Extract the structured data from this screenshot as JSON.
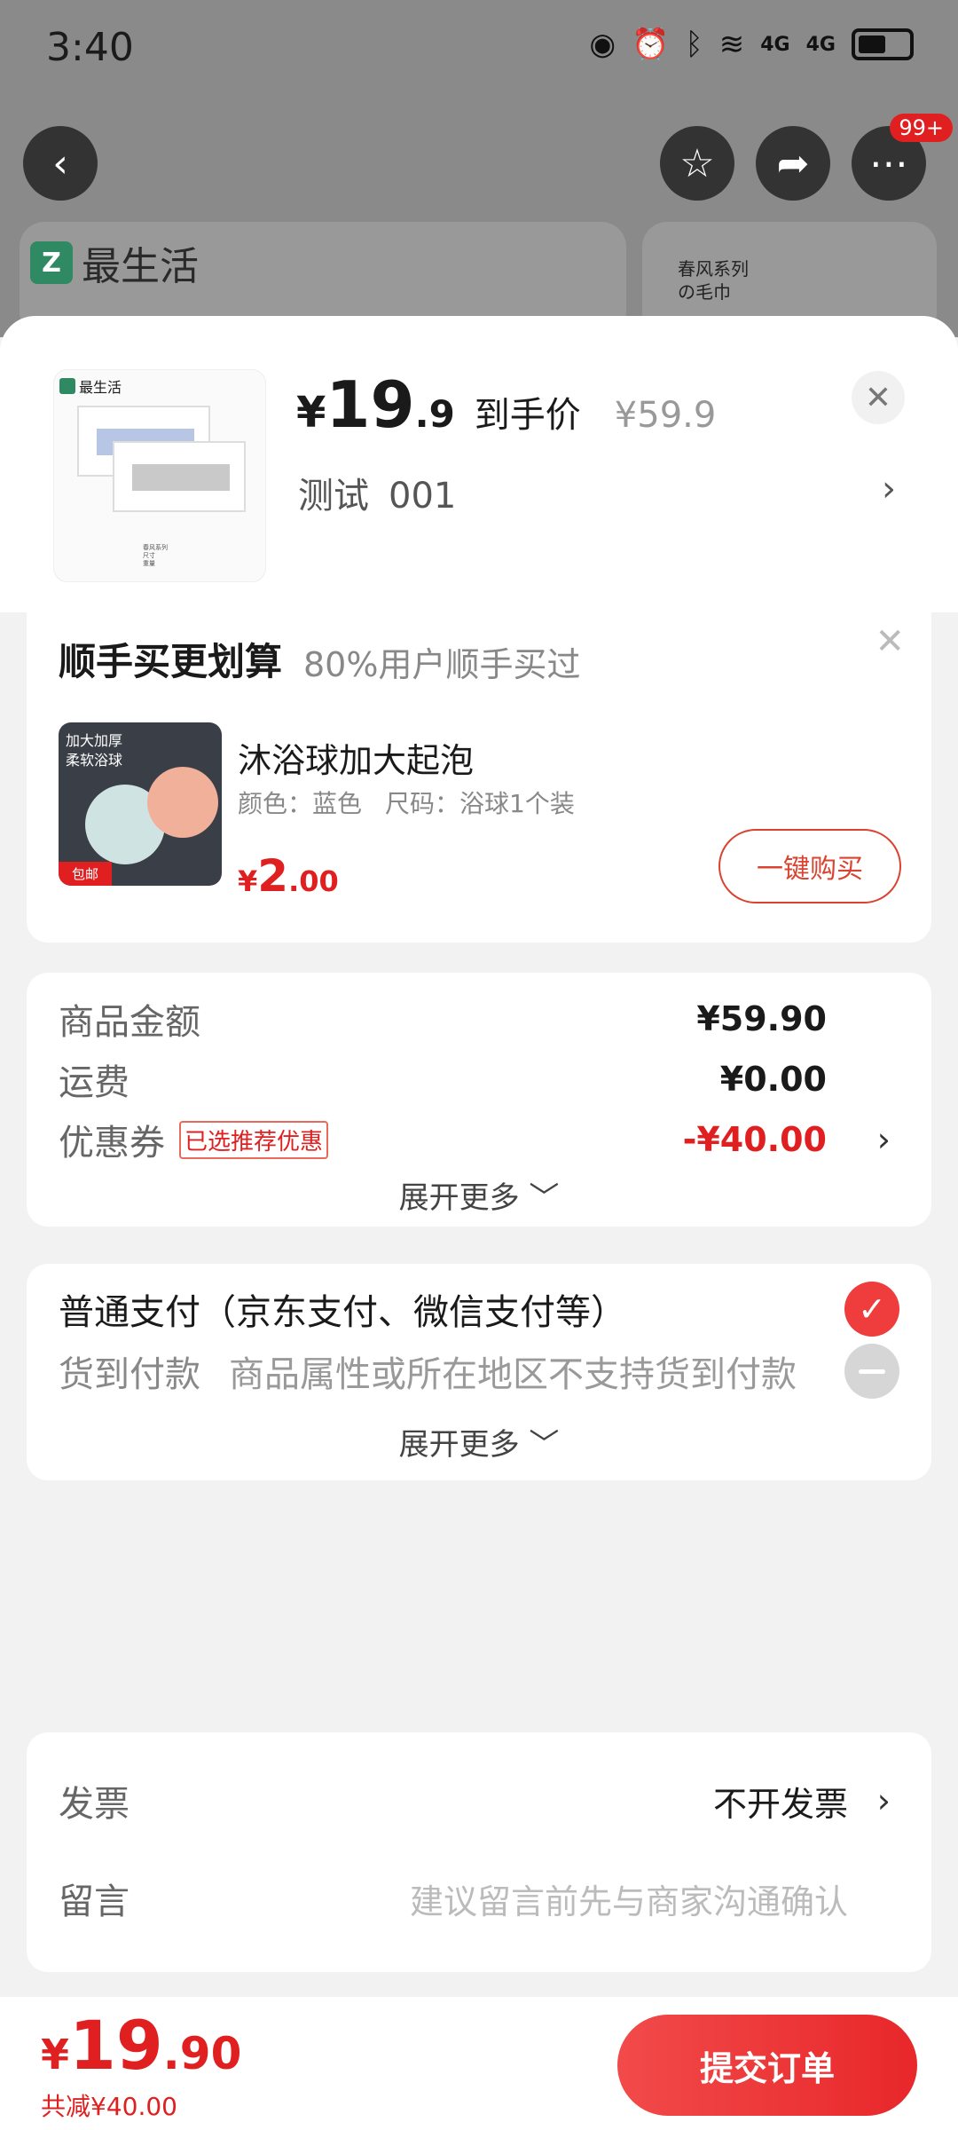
{
  "status_bar": {
    "time": "3:40",
    "net1": "4G",
    "net2": "4G"
  },
  "background": {
    "back_icon": "‹",
    "more_badge": "99+",
    "brand": "最生活",
    "brand_letter": "Z",
    "side_card_line1": "春风系列",
    "side_card_line2": "の毛巾"
  },
  "product": {
    "thumb_brand": "最生活",
    "price_symbol": "¥",
    "price_int": "19",
    "price_dec": ".9",
    "price_label": "到手价",
    "original_price": "¥59.9",
    "spec_name": "测试",
    "spec_value": "001"
  },
  "addon": {
    "title": "顺手买更划算",
    "subtitle": "80%用户顺手买过",
    "img_text1": "加大加厚",
    "img_text2": "柔软浴球",
    "img_tag": "包邮",
    "name": "沐浴球加大起泡",
    "attr_color": "颜色：蓝色",
    "attr_size": "尺码：浴球1个装",
    "price_symbol": "¥",
    "price_int": "2",
    "price_dec": ".00",
    "buy_label": "一键购买"
  },
  "amounts": {
    "goods_label": "商品金额",
    "goods_value": "¥59.90",
    "shipping_label": "运费",
    "shipping_value": "¥0.00",
    "coupon_label": "优惠券",
    "coupon_badge": "已选推荐优惠",
    "coupon_value": "-¥40.00",
    "expand_label": "展开更多"
  },
  "payment": {
    "normal_label": "普通支付（京东支付、微信支付等）",
    "cod_label": "货到付款",
    "cod_note": "商品属性或所在地区不支持货到付款",
    "expand_label": "展开更多"
  },
  "extra": {
    "invoice_label": "发票",
    "invoice_value": "不开发票",
    "message_label": "留言",
    "message_placeholder": "建议留言前先与商家沟通确认"
  },
  "footer": {
    "total_symbol": "¥",
    "total_int": "19",
    "total_dec": ".90",
    "saved_text": "共减¥40.00",
    "submit_label": "提交订单"
  },
  "colors": {
    "accent": "#e02020",
    "brand": "#2f8a63"
  }
}
